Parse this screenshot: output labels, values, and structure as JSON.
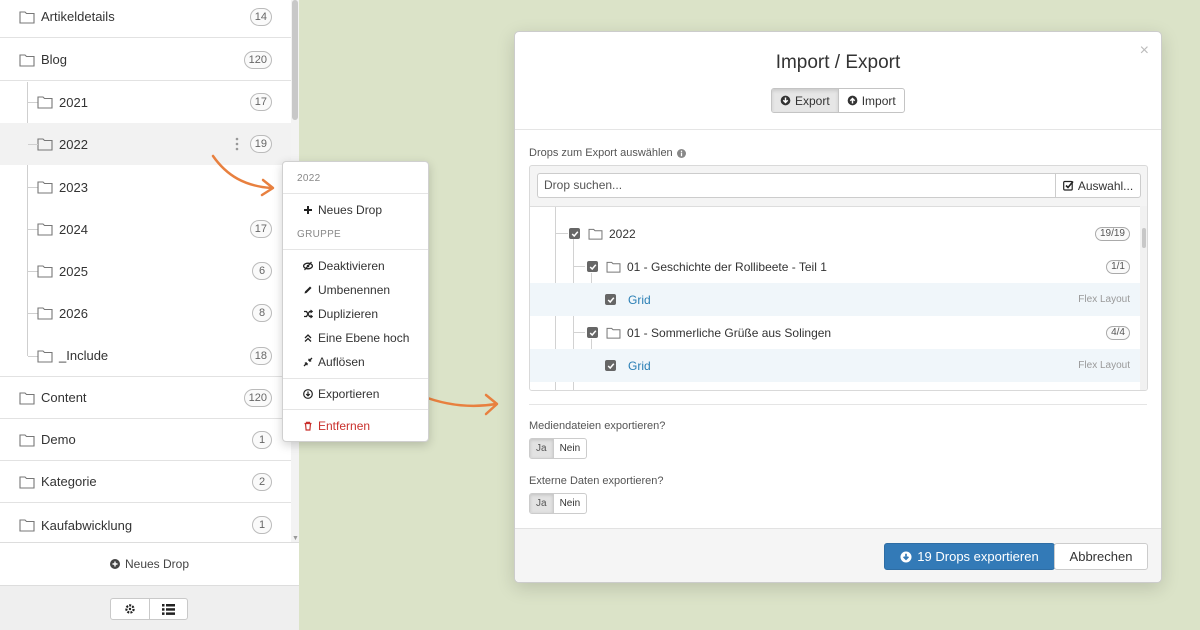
{
  "sidebar": {
    "items": [
      {
        "label": "Artikeldetails",
        "count": "14",
        "level": 0
      },
      {
        "label": "Blog",
        "count": "120",
        "level": 0
      },
      {
        "label": "2021",
        "count": "17",
        "level": 1
      },
      {
        "label": "2022",
        "count": "19",
        "level": 1,
        "selected": true
      },
      {
        "label": "2023",
        "count": "",
        "level": 1
      },
      {
        "label": "2024",
        "count": "17",
        "level": 1
      },
      {
        "label": "2025",
        "count": "6",
        "level": 1
      },
      {
        "label": "2026",
        "count": "8",
        "level": 1
      },
      {
        "label": "_Include",
        "count": "18",
        "level": 1
      },
      {
        "label": "Content",
        "count": "120",
        "level": 0
      },
      {
        "label": "Demo",
        "count": "1",
        "level": 0
      },
      {
        "label": "Kategorie",
        "count": "2",
        "level": 0
      },
      {
        "label": "Kaufabwicklung",
        "count": "1",
        "level": 0
      }
    ],
    "new_drop_label": "Neues Drop"
  },
  "context_menu": {
    "title": "2022",
    "new_drop": "Neues Drop",
    "group_header": "GRUPPE",
    "deactivate": "Deaktivieren",
    "rename": "Umbenennen",
    "duplicate": "Duplizieren",
    "level_up": "Eine Ebene hoch",
    "dissolve": "Auflösen",
    "export": "Exportieren",
    "remove": "Entfernen"
  },
  "modal": {
    "title": "Import / Export",
    "close": "×",
    "tab_export": "Export",
    "tab_import": "Import",
    "select_label": "Drops zum Export auswählen",
    "search_placeholder": "Drop suchen...",
    "select_button": "Auswahl...",
    "tree": [
      {
        "label": "2022",
        "badge": "19/19",
        "kind": "folder"
      },
      {
        "label": "01 - Geschichte der Rollibeete - Teil 1",
        "badge": "1/1",
        "kind": "folder"
      },
      {
        "label": "Grid",
        "type": "Flex Layout",
        "kind": "drop"
      },
      {
        "label": "01 - Sommerliche Grüße aus Solingen",
        "badge": "4/4",
        "kind": "folder"
      },
      {
        "label": "Grid",
        "type": "Flex Layout",
        "kind": "drop"
      }
    ],
    "media_question": "Mediendateien exportieren?",
    "external_question": "Externe Daten exportieren?",
    "yes": "Ja",
    "no": "Nein",
    "export_button": "19 Drops exportieren",
    "cancel_button": "Abbrechen"
  },
  "colors": {
    "background": "#dbe3c8",
    "accent": "#337ab7",
    "arrow": "#e8803f",
    "danger": "#c9302c",
    "link": "#2a7fb5"
  }
}
